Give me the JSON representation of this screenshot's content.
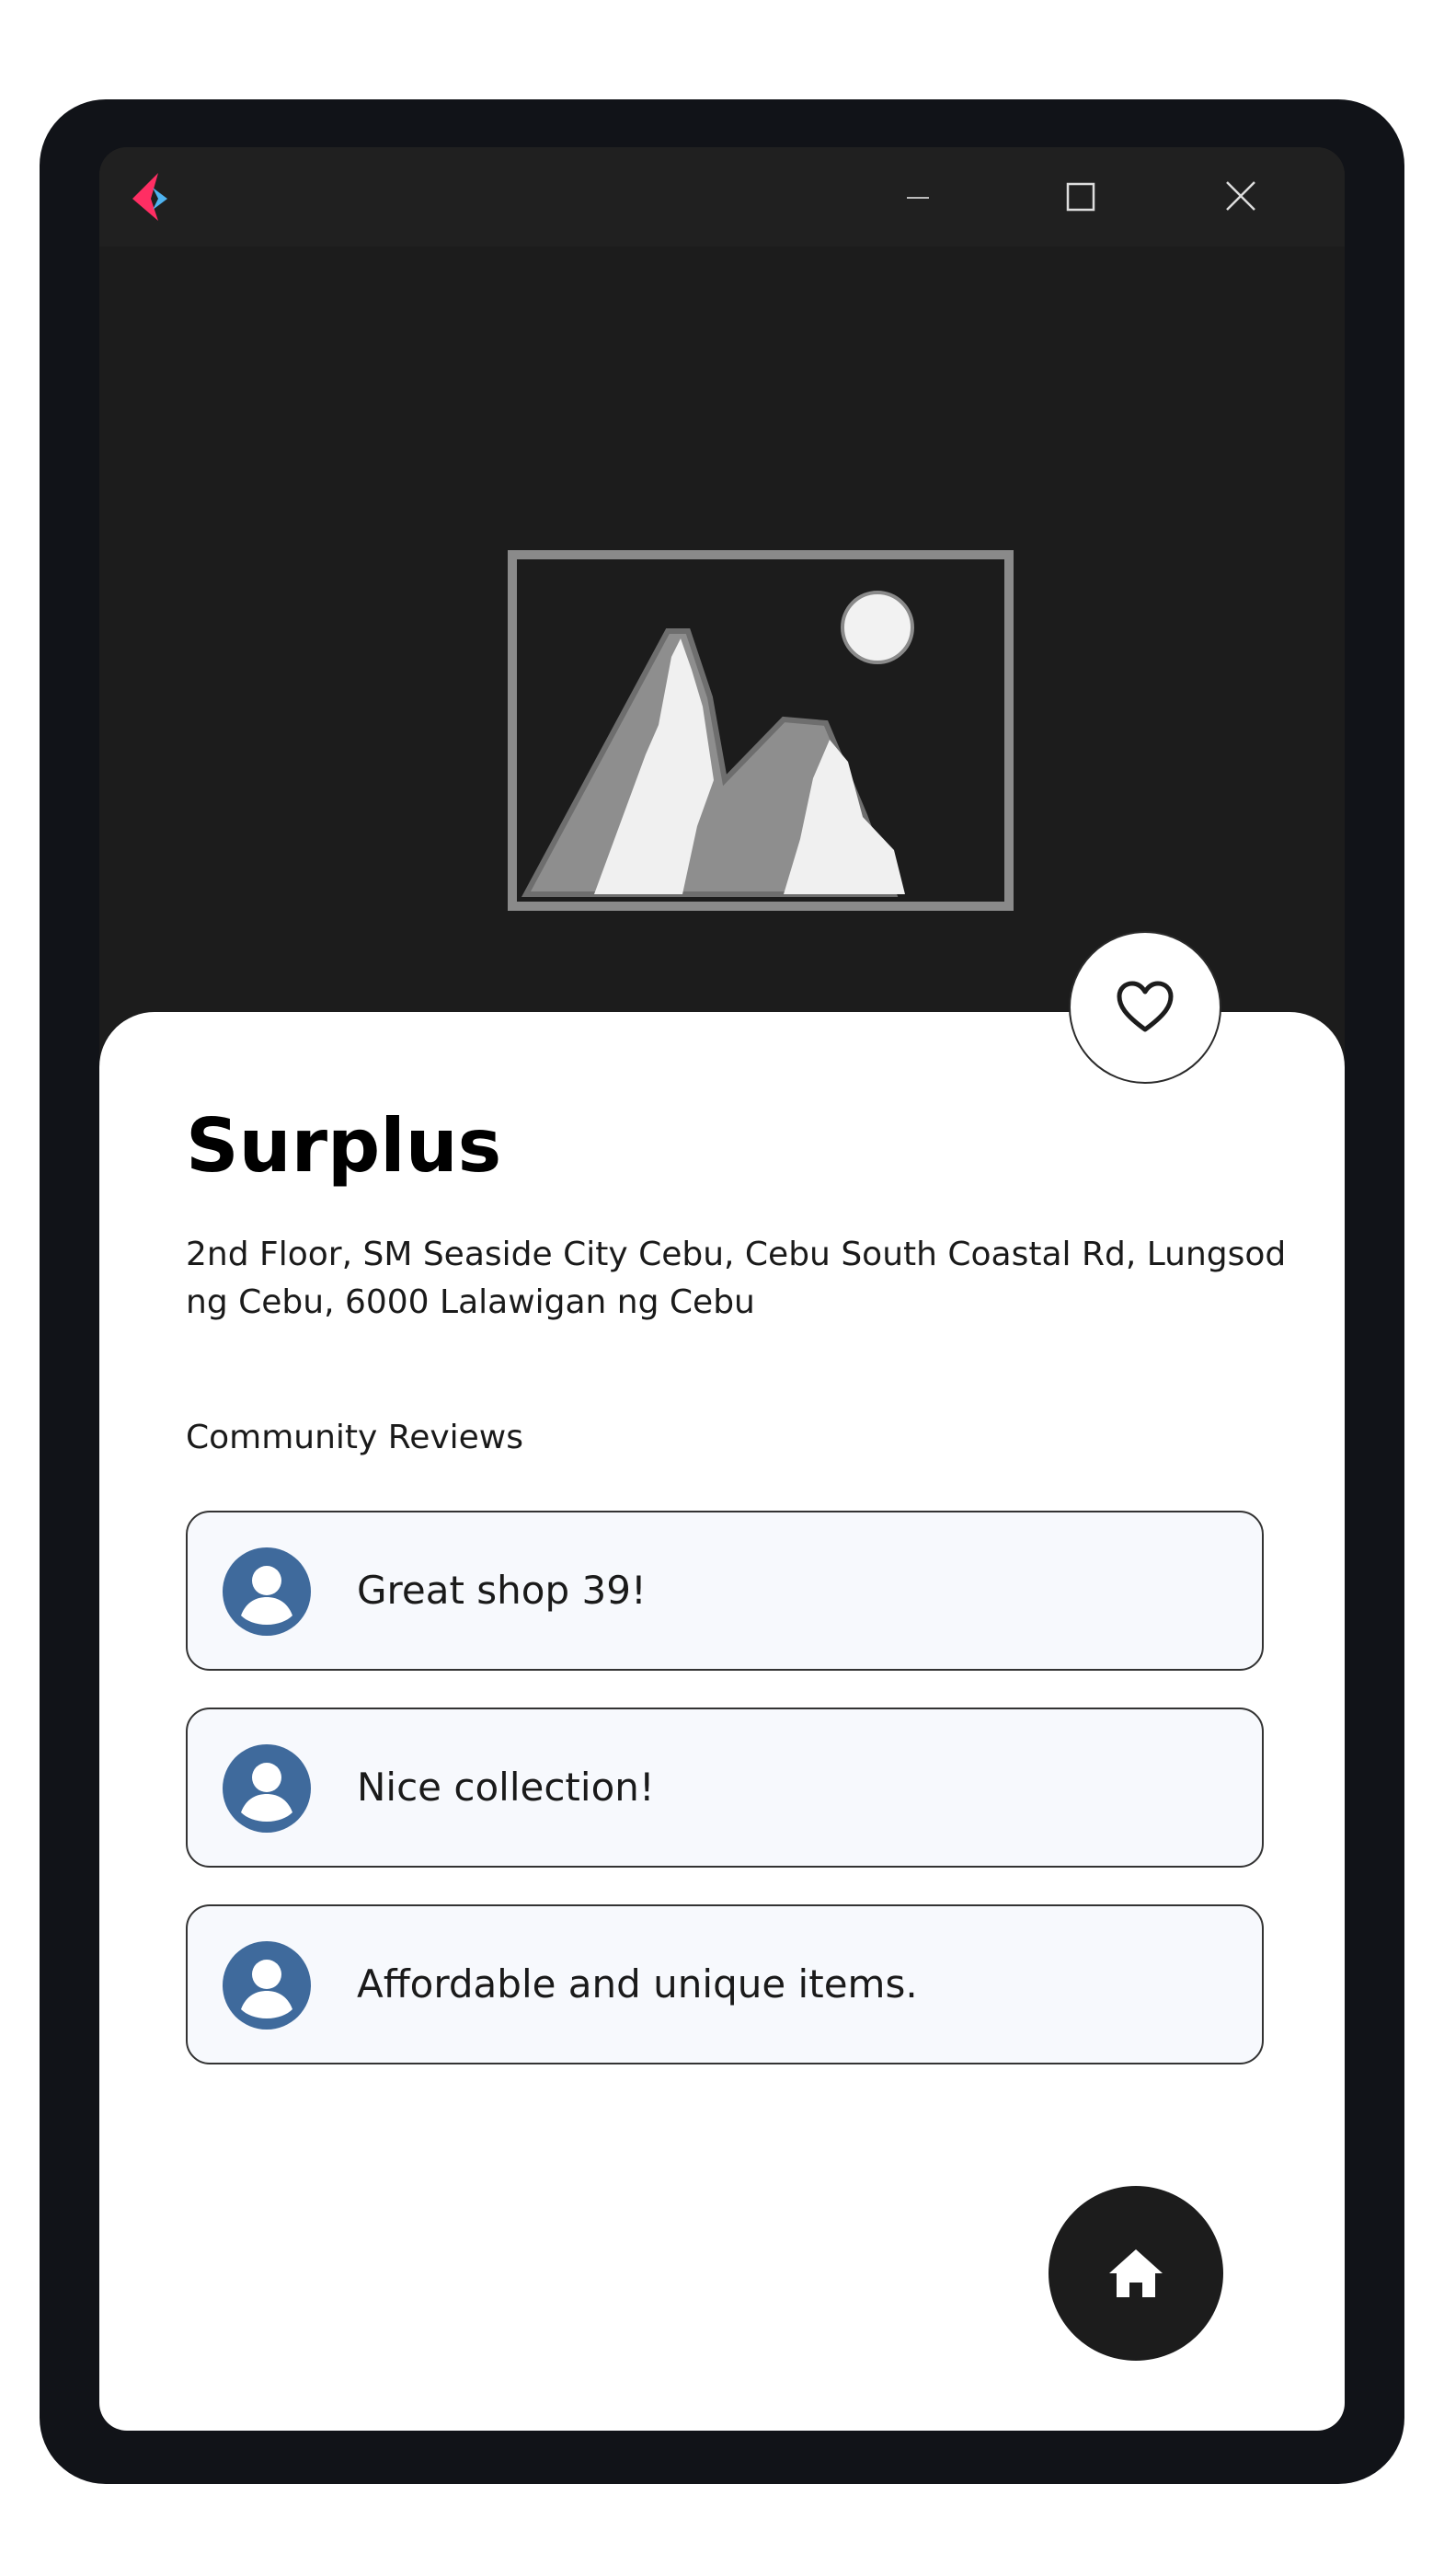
{
  "window": {
    "controls": {
      "minimize_icon": "minimize-icon",
      "maximize_icon": "maximize-icon",
      "close_icon": "close-icon"
    }
  },
  "colors": {
    "frame": "#111318",
    "window_bg": "#1c1c1c",
    "card_bg": "#ffffff",
    "avatar_blue": "#3f6a9c",
    "logo_pink": "#ff2e63",
    "logo_blue": "#4fb3f0"
  },
  "hero": {
    "image_icon": "image-placeholder-icon"
  },
  "store": {
    "name": "Surplus",
    "address": "2nd Floor, SM Seaside City Cebu, Cebu South Coastal Rd, Lungsod ng Cebu, 6000 Lalawigan ng Cebu",
    "favorite_icon": "heart-icon"
  },
  "reviews": {
    "label": "Community Reviews",
    "items": [
      {
        "text": "Great shop 39!",
        "avatar_icon": "user-avatar-icon"
      },
      {
        "text": "Nice collection!",
        "avatar_icon": "user-avatar-icon"
      },
      {
        "text": "Affordable and unique items.",
        "avatar_icon": "user-avatar-icon"
      }
    ]
  },
  "nav": {
    "home_icon": "home-icon"
  }
}
